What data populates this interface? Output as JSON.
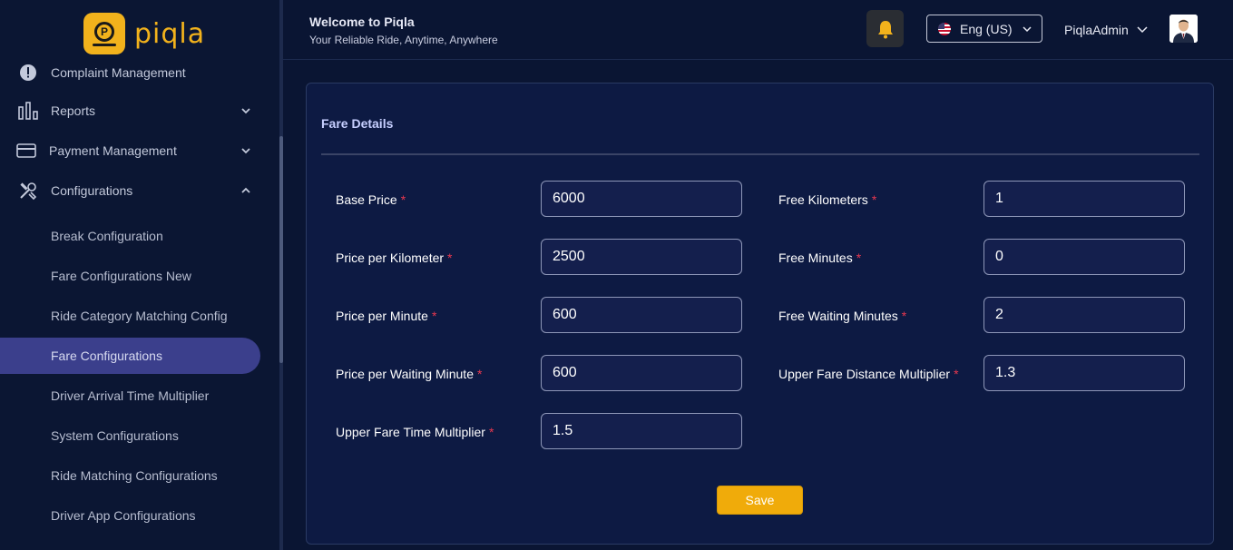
{
  "brand": {
    "logo_letter": "P",
    "name": "piqla",
    "accent": "#f2b21c"
  },
  "sidebar": {
    "items": [
      {
        "label": "Complaint Management",
        "icon": "alert-circle-icon"
      },
      {
        "label": "Reports",
        "icon": "bar-chart-icon",
        "chevron": "chevron-down-icon"
      },
      {
        "label": "Payment Management",
        "icon": "credit-card-icon",
        "chevron": "chevron-down-icon"
      },
      {
        "label": "Configurations",
        "icon": "tools-icon",
        "chevron": "chevron-up-icon",
        "expanded": true
      }
    ],
    "sub_items": [
      {
        "label": "Break Configuration"
      },
      {
        "label": "Fare Configurations New"
      },
      {
        "label": "Ride Category Matching Config"
      },
      {
        "label": "Fare Configurations",
        "active": true
      },
      {
        "label": "Driver Arrival Time Multiplier"
      },
      {
        "label": "System Configurations"
      },
      {
        "label": "Ride Matching Configurations"
      },
      {
        "label": "Driver App Configurations"
      }
    ]
  },
  "header": {
    "welcome": "Welcome to Piqla",
    "tagline": "Your Reliable Ride, Anytime, Anywhere",
    "language": "Eng (US)",
    "user_name": "PiqlaAdmin"
  },
  "form": {
    "title": "Fare Details",
    "required_mark": "*",
    "fields": [
      {
        "label": "Base Price",
        "value": "6000"
      },
      {
        "label": "Free Kilometers",
        "value": "1"
      },
      {
        "label": "Price per Kilometer",
        "value": "2500"
      },
      {
        "label": "Free Minutes",
        "value": "0"
      },
      {
        "label": "Price per Minute",
        "value": "600"
      },
      {
        "label": "Free Waiting Minutes",
        "value": "2"
      },
      {
        "label": "Price per Waiting Minute",
        "value": "600"
      },
      {
        "label": "Upper Fare Distance Multiplier",
        "value": "1.3"
      },
      {
        "label": "Upper Fare Time Multiplier",
        "value": "1.5"
      }
    ],
    "save_label": "Save"
  },
  "colors": {
    "background": "#0a1533",
    "card": "#0d1a43",
    "active_nav": "#3b3f8c",
    "required": "#e8384f",
    "save_button": "#f0ab0a"
  }
}
